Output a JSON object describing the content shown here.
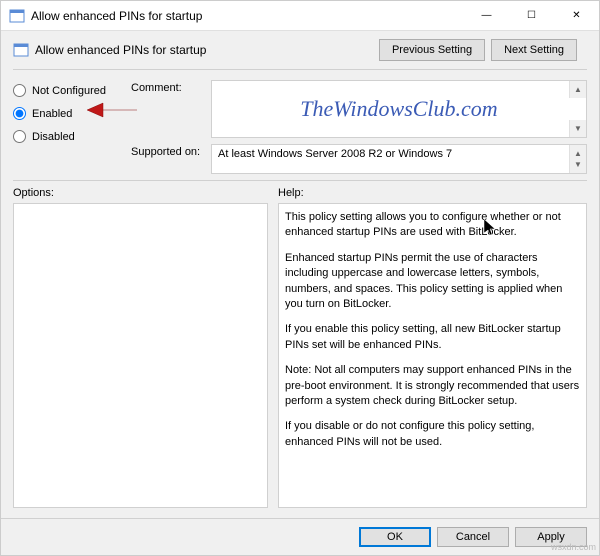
{
  "title": "Allow enhanced PINs for startup",
  "subtitle": "Allow enhanced PINs for startup",
  "nav": {
    "prev": "Previous Setting",
    "next": "Next Setting"
  },
  "radio": {
    "not_configured": "Not Configured",
    "enabled": "Enabled",
    "disabled": "Disabled",
    "selected": "enabled"
  },
  "labels": {
    "comment": "Comment:",
    "supported": "Supported on:",
    "options": "Options:",
    "help": "Help:"
  },
  "supported_text": "At least Windows Server 2008 R2 or Windows 7",
  "watermark": "TheWindowsClub.com",
  "help": {
    "p1": "This policy setting allows you to configure whether or not enhanced startup PINs are used with BitLocker.",
    "p2": "Enhanced startup PINs permit the use of characters including uppercase and lowercase letters, symbols, numbers, and spaces. This policy setting is applied when you turn on BitLocker.",
    "p3": "If you enable this policy setting, all new BitLocker startup PINs set will be enhanced PINs.",
    "p4": "Note:   Not all computers may support enhanced PINs in the pre-boot environment. It is strongly recommended that users perform a system check during BitLocker setup.",
    "p5": "If you disable or do not configure this policy setting, enhanced PINs will not be used."
  },
  "footer": {
    "ok": "OK",
    "cancel": "Cancel",
    "apply": "Apply"
  },
  "source_label": "wsxdn.com"
}
